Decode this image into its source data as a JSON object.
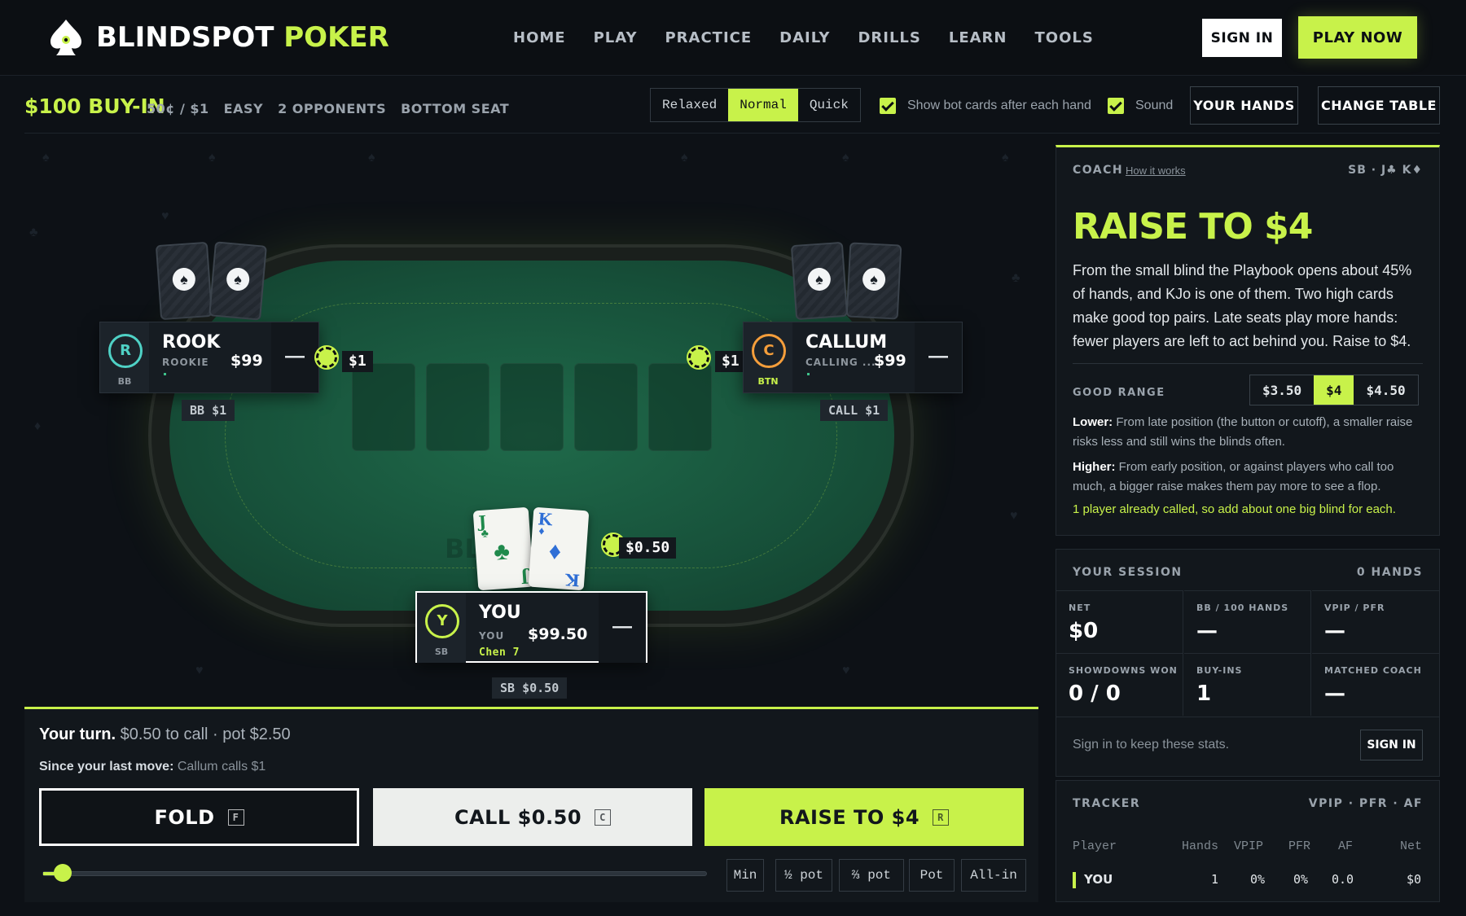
{
  "brand": {
    "name_part1": "BLINDSPOT",
    "name_part2": "POKER",
    "accent": "#c8f24a",
    "bg": "#0d1116"
  },
  "nav": {
    "links": [
      "HOME",
      "PLAY",
      "PRACTICE",
      "DAILY",
      "DRILLS",
      "LEARN",
      "TOOLS"
    ],
    "signin_label": "SIGN IN",
    "playnow_label": "PLAY NOW"
  },
  "subbar": {
    "buyin": "$100 BUY-IN",
    "stakes": [
      "50¢ / $1",
      "EASY",
      "2 OPPONENTS",
      "BOTTOM SEAT"
    ],
    "speed_options": [
      "Relaxed",
      "Normal",
      "Quick"
    ],
    "speed_selected": "Normal",
    "show_bot_cards": {
      "label": "Show bot cards after each hand",
      "checked": true
    },
    "sound": {
      "label": "Sound",
      "checked": true
    },
    "your_hands_label": "YOUR HANDS",
    "change_table_label": "CHANGE TABLE"
  },
  "table": {
    "watermark": "BL",
    "seats": {
      "left": {
        "initial": "R",
        "name": "ROOK",
        "tag": "ROOKIE",
        "stack": "$99",
        "position": "BB",
        "bet": "$1",
        "label": "BB $1",
        "action": "—",
        "color": "#4fd1c5"
      },
      "right": {
        "initial": "C",
        "name": "CALLUM",
        "tag": "CALLING ...",
        "stack": "$99",
        "position": "BTN",
        "bet": "$1",
        "label": "CALL $1",
        "action": "—",
        "color": "#f59e3b"
      },
      "hero": {
        "initial": "Y",
        "name": "YOU",
        "tag": "YOU",
        "player": "Chen 7",
        "stack": "$99.50",
        "position": "SB",
        "bet": "$0.50",
        "label": "SB $0.50",
        "action": "—",
        "color": "#c8f24a"
      }
    },
    "hero_cards": [
      {
        "rank": "J",
        "suit": "♣",
        "color": "#1f8a4c"
      },
      {
        "rank": "K",
        "suit": "♦",
        "color": "#2f6fd6"
      }
    ],
    "card_back_icon": "spade-icon"
  },
  "action": {
    "turn_bold": "Your turn.",
    "turn_rest": "$0.50 to call · pot $2.50",
    "since_label": "Since your last move:",
    "since_value": "Callum calls $1",
    "fold_label": "FOLD",
    "fold_key": "F",
    "call_label": "CALL $0.50",
    "call_key": "C",
    "raise_label": "RAISE TO $4",
    "raise_key": "R",
    "slider_level": 0.02,
    "size_buttons": [
      "Min",
      "½ pot",
      "⅔ pot",
      "Pot",
      "All-in"
    ]
  },
  "coach": {
    "title": "COACH",
    "how_link": "How it works",
    "hand": "SB · J♣ K♦",
    "headline": "RAISE TO $4",
    "body": "From the small blind the Playbook opens about 45% of hands, and KJo is one of them. Two high cards make good top pairs. Late seats play more hands: fewer players are left to act behind you. Raise to $4.",
    "range_label": "GOOD RANGE",
    "range_options": [
      "$3.50",
      "$4",
      "$4.50"
    ],
    "range_selected": "$4",
    "lower_label": "Lower:",
    "lower_text": "From late position (the button or cutoff), a smaller raise risks less and still wins the blinds often.",
    "higher_label": "Higher:",
    "higher_text": "From early position, or against players who call too much, a bigger raise makes them pay more to see a flop.",
    "tip": "1 player already called, so add about one big blind for each."
  },
  "session": {
    "title": "YOUR SESSION",
    "hands": "0 HANDS",
    "stats": [
      {
        "label": "NET",
        "value": "$0"
      },
      {
        "label": "BB / 100 HANDS",
        "value": "—"
      },
      {
        "label": "VPIP / PFR",
        "value": "—"
      },
      {
        "label": "SHOWDOWNS WON",
        "value": "0 / 0"
      },
      {
        "label": "BUY-INS",
        "value": "1"
      },
      {
        "label": "MATCHED COACH",
        "value": "—"
      }
    ],
    "footer_text": "Sign in to keep these stats.",
    "footer_button": "SIGN IN"
  },
  "tracker": {
    "title": "TRACKER",
    "cols_summary": "VPIP · PFR · AF",
    "headers": [
      "Player",
      "Hands",
      "VPIP",
      "PFR",
      "AF",
      "Net"
    ],
    "rows": [
      {
        "player": "YOU",
        "hands": "1",
        "vpip": "0%",
        "pfr": "0%",
        "af": "0.0",
        "net": "$0"
      }
    ]
  }
}
